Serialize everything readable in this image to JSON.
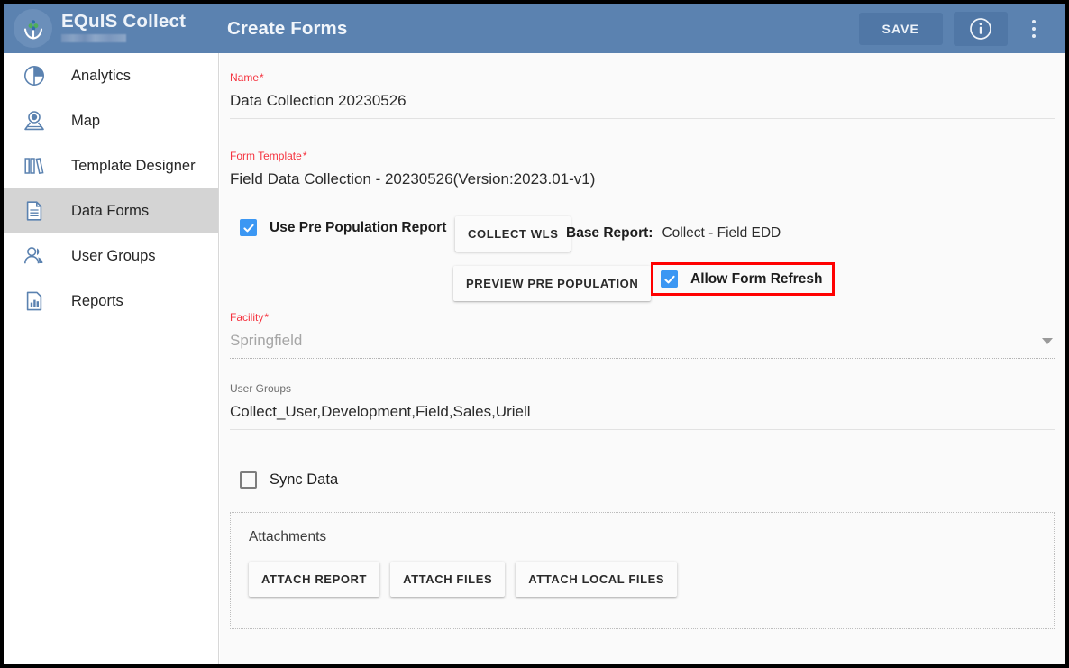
{
  "header": {
    "brand_title": "EQuIS Collect",
    "brand_subtitle_redacted": "",
    "page_title": "Create Forms",
    "save_label": "SAVE",
    "info_icon": "info-circle-icon",
    "menu_icon": "kebab-menu-icon",
    "logo_icon": "equis-leaf-logo-icon",
    "bg_color": "#5b82b0",
    "button_bg_color": "#5077a6"
  },
  "sidebar": {
    "items": [
      {
        "label": "Analytics",
        "icon": "pie-chart-icon",
        "active": false
      },
      {
        "label": "Map",
        "icon": "map-pin-icon",
        "active": false
      },
      {
        "label": "Template Designer",
        "icon": "books-icon",
        "active": false
      },
      {
        "label": "Data Forms",
        "icon": "document-icon",
        "active": true
      },
      {
        "label": "User Groups",
        "icon": "users-icon",
        "active": false
      },
      {
        "label": "Reports",
        "icon": "report-bar-chart-icon",
        "active": false
      }
    ],
    "active_bg_color": "#d4d4d4"
  },
  "form": {
    "name": {
      "label": "Name",
      "required": true,
      "value": "Data Collection 20230526"
    },
    "form_template": {
      "label": "Form Template",
      "required": true,
      "value": "Field Data Collection - 20230526(Version:2023.01-v1)"
    },
    "pre_population": {
      "use_report_label": "Use Pre Population Report",
      "use_report_checked": true,
      "collect_wls_label": "COLLECT WLS",
      "base_report_label": "Base Report:",
      "base_report_value": "Collect - Field EDD",
      "preview_label": "PREVIEW PRE POPULATION",
      "allow_refresh_label": "Allow Form Refresh",
      "allow_refresh_checked": true,
      "highlight_color": "#ff0000"
    },
    "facility": {
      "label": "Facility",
      "required": true,
      "value": "Springfield",
      "muted": true,
      "caret_icon": "chevron-down-icon"
    },
    "user_groups": {
      "label": "User Groups",
      "required": false,
      "value": "Collect_User,Development,Field,Sales,Uriell"
    },
    "sync_data": {
      "label": "Sync Data",
      "checked": false
    },
    "attachments": {
      "title": "Attachments",
      "buttons": [
        {
          "label": "ATTACH REPORT"
        },
        {
          "label": "ATTACH FILES"
        },
        {
          "label": "ATTACH LOCAL FILES"
        }
      ]
    }
  },
  "colors": {
    "checkbox_checked": "#3b97f3",
    "required_label": "#f5333f",
    "content_bg": "#fafafa"
  }
}
